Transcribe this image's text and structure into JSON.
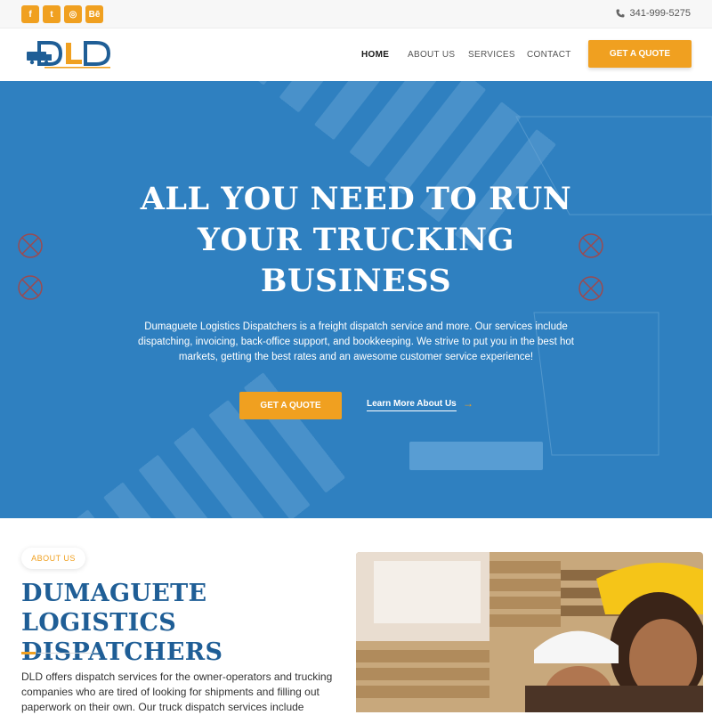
{
  "topbar": {
    "social": [
      {
        "icon": "facebook-icon",
        "glyph": "f"
      },
      {
        "icon": "twitter-icon",
        "glyph": "t"
      },
      {
        "icon": "instagram-icon",
        "glyph": "◎"
      },
      {
        "icon": "behance-icon",
        "glyph": "Bē"
      }
    ],
    "phone": "341-999-5275"
  },
  "nav": {
    "logo_text": "DLD",
    "items": [
      "HOME",
      "ABOUT US",
      "SERVICES",
      "CONTACT"
    ],
    "active": "HOME",
    "cta": "GET A QUOTE"
  },
  "hero": {
    "title_line1": "ALL YOU NEED TO RUN",
    "title_line2": "YOUR TRUCKING",
    "title_line3": "BUSINESS",
    "text": "Dumaguete Logistics Dispatchers is a freight dispatch service and more. Our services include dispatching, invoicing, back-office support, and bookkeeping. We strive to put you in the best hot markets, getting the best rates and an awesome customer service experience!",
    "cta": "GET A QUOTE",
    "link": "Learn More About Us",
    "arrow": "→"
  },
  "about": {
    "badge": "ABOUT US",
    "title_line1": "DUMAGUETE LOGISTICS",
    "title_line2": "DISPATCHERS",
    "text": "DLD offers dispatch services for the owner-operators and trucking companies who are tired of looking for shipments and filling out paperwork on their own. Our truck dispatch services include"
  },
  "colors": {
    "accent": "#f0a020",
    "brand_blue": "#1f5e96",
    "hero_overlay": "#2e7fbf"
  }
}
